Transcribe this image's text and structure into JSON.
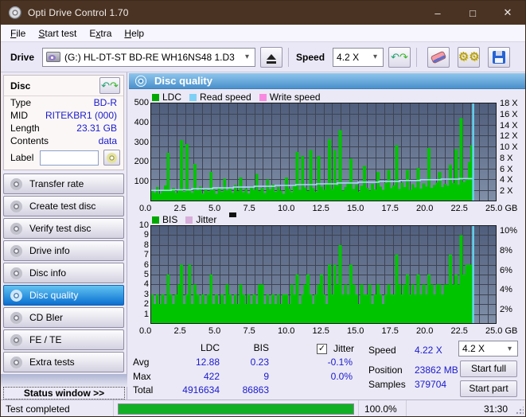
{
  "titlebar": {
    "title": "Opti Drive Control 1.70",
    "minimize": "–",
    "maximize": "□",
    "close": "✕"
  },
  "menu": {
    "items": [
      {
        "label": "File",
        "accel": 0
      },
      {
        "label": "Start test",
        "accel": 0
      },
      {
        "label": "Extra",
        "accel": 1
      },
      {
        "label": "Help",
        "accel": 0
      }
    ]
  },
  "toolbar": {
    "drive_label": "Drive",
    "drive_value": "(G:)  HL-DT-ST BD-RE  WH16NS48 1.D3",
    "speed_label": "Speed",
    "speed_value": "4.2 X",
    "icons": [
      "drive-icon",
      "eject-icon",
      "refresh-icon",
      "eraser-icon",
      "gears-icon",
      "save-icon"
    ]
  },
  "sidebar": {
    "panel_title": "Disc",
    "disc": {
      "rows": [
        {
          "label": "Type",
          "value": "BD-R"
        },
        {
          "label": "MID",
          "value": "RITEKBR1 (000)"
        },
        {
          "label": "Length",
          "value": "23.31 GB"
        },
        {
          "label": "Contents",
          "value": "data"
        }
      ],
      "label_field": {
        "label": "Label",
        "value": ""
      }
    },
    "buttons": [
      "Transfer rate",
      "Create test disc",
      "Verify test disc",
      "Drive info",
      "Disc info",
      "Disc quality",
      "CD Bler",
      "FE / TE",
      "Extra tests"
    ],
    "active_button": "Disc quality",
    "status_window": "Status window >>"
  },
  "main": {
    "header": "Disc quality"
  },
  "chart_data": [
    {
      "type": "bar",
      "title": "LDC / Read speed vs position",
      "legend": [
        {
          "label": "LDC",
          "color": "#00a800"
        },
        {
          "label": "Read speed",
          "color": "#7fd0f5"
        },
        {
          "label": "Write speed",
          "color": "#f78ae0"
        }
      ],
      "xlabel": "GB",
      "xlim": [
        0,
        25
      ],
      "x_ticks": [
        "0.0",
        "2.5",
        "5.0",
        "7.5",
        "10.0",
        "12.5",
        "15.0",
        "17.5",
        "20.0",
        "22.5",
        "25.0"
      ],
      "left_axis": {
        "ticks": [
          500,
          400,
          300,
          200,
          100
        ],
        "max": 500
      },
      "right_axis": {
        "ticks": [
          "18 X",
          "16 X",
          "14 X",
          "12 X",
          "10 X",
          "8 X",
          "6 X",
          "4 X",
          "2 X"
        ],
        "max": 18
      },
      "data_end_gb": 23.31,
      "series": [
        {
          "name": "LDC",
          "type": "bar",
          "color": "#00c400",
          "step_gb": 0.19425,
          "values": [
            60,
            45,
            72,
            38,
            55,
            80,
            245,
            52,
            68,
            42,
            58,
            310,
            49,
            290,
            63,
            44,
            190,
            57,
            75,
            41,
            66,
            50,
            150,
            61,
            39,
            73,
            48,
            115,
            56,
            70,
            44,
            82,
            53,
            120,
            47,
            65,
            40,
            76,
            58,
            140,
            52,
            69,
            43,
            110,
            61,
            85,
            49,
            72,
            55,
            38,
            120,
            64,
            47,
            78,
            250,
            59,
            230,
            70,
            52,
            260,
            66,
            48,
            230,
            75,
            58,
            90,
            315,
            62,
            260,
            80,
            360,
            55,
            72,
            95,
            215,
            63,
            85,
            49,
            78,
            180,
            68,
            54,
            88,
            60,
            150,
            74,
            58,
            92,
            160,
            66,
            80,
            285,
            62,
            95,
            72,
            160,
            58,
            86,
            70,
            170,
            64,
            90,
            75,
            270,
            68,
            82,
            95,
            150,
            72,
            88,
            78,
            185,
            92,
            265,
            85,
            422,
            96,
            110,
            200,
            285
          ]
        },
        {
          "name": "Read speed",
          "type": "line",
          "color": "#a9d7f7",
          "points_gb_speed": [
            [
              0,
              2.0
            ],
            [
              1.5,
              2.1
            ],
            [
              3,
              2.3
            ],
            [
              4.5,
              2.45
            ],
            [
              6,
              2.6
            ],
            [
              7.5,
              2.75
            ],
            [
              9,
              2.9
            ],
            [
              10.5,
              3.05
            ],
            [
              12,
              3.2
            ],
            [
              13.5,
              3.35
            ],
            [
              15,
              3.5
            ],
            [
              16.5,
              3.65
            ],
            [
              18,
              3.8
            ],
            [
              19.5,
              3.95
            ],
            [
              21,
              4.05
            ],
            [
              22.3,
              4.15
            ],
            [
              23.31,
              4.3
            ]
          ]
        },
        {
          "name": "Write speed",
          "type": "line",
          "color": "#f78ae0",
          "points_gb_speed": []
        }
      ],
      "end_marker": {
        "x_gb": 23.31,
        "color": "#66d8f4"
      },
      "grid": {
        "v_divisions": 40,
        "h_divisions": 9,
        "color": "#3d4452"
      },
      "bg_gradient": [
        "#4f5d7c",
        "#8190a8"
      ]
    },
    {
      "type": "bar",
      "title": "BIS / Jitter vs position",
      "legend": [
        {
          "label": "BIS",
          "color": "#00a800"
        },
        {
          "label": "Jitter",
          "color": "#d8aeda"
        }
      ],
      "xlabel": "GB",
      "xlim": [
        0,
        25
      ],
      "x_ticks": [
        "0.0",
        "2.5",
        "5.0",
        "7.5",
        "10.0",
        "12.5",
        "15.0",
        "17.5",
        "20.0",
        "22.5",
        "25.0"
      ],
      "left_axis": {
        "ticks": [
          10,
          9,
          8,
          7,
          6,
          5,
          4,
          3,
          2,
          1
        ],
        "max": 10
      },
      "right_axis": {
        "ticks": [
          "10%",
          "8%",
          "6%",
          "4%",
          "2%"
        ],
        "max": 10
      },
      "data_end_gb": 23.31,
      "series": [
        {
          "name": "BIS",
          "type": "bar",
          "color": "#00c400",
          "step_gb": 0.19425,
          "values": [
            3,
            2,
            3,
            2,
            3,
            2,
            5,
            3,
            2,
            3,
            4,
            6,
            2,
            3,
            6,
            2,
            4,
            3,
            2,
            3,
            2,
            3,
            5,
            2,
            3,
            2,
            3,
            2,
            4,
            3,
            2,
            3,
            2,
            4,
            3,
            2,
            3,
            2,
            3,
            2,
            4,
            4,
            2,
            3,
            2,
            3,
            2,
            3,
            2,
            3,
            3,
            2,
            4,
            3,
            5,
            2,
            3,
            4,
            5,
            3,
            2,
            3,
            4,
            5,
            3,
            2,
            6,
            3,
            6,
            4,
            8,
            3,
            4,
            3,
            6,
            4,
            3,
            2,
            4,
            3,
            3,
            4,
            2,
            3,
            4,
            3,
            2,
            3,
            4,
            3,
            3,
            7,
            4,
            3,
            4,
            5,
            3,
            4,
            3,
            5,
            3,
            4,
            3,
            5,
            4,
            3,
            4,
            4,
            3,
            4,
            4,
            7,
            4,
            5,
            4,
            9,
            5,
            6,
            6,
            6
          ]
        },
        {
          "name": "Jitter",
          "type": "line",
          "color": "#d8aeda",
          "points_gb_speed": []
        }
      ],
      "end_marker": {
        "x_gb": 23.31,
        "color": "#66d8f4"
      },
      "grid": {
        "v_divisions": 40,
        "h_divisions": 10,
        "color": "#3d4452"
      },
      "bg_gradient": [
        "#4f5d7c",
        "#8190a8"
      ]
    }
  ],
  "stats": {
    "col_ldc": "LDC",
    "col_bis": "BIS",
    "jitter_label": "Jitter",
    "jitter_checked": true,
    "rows": [
      {
        "label": "Avg",
        "ldc": "12.88",
        "bis": "0.23",
        "jitter": "-0.1%"
      },
      {
        "label": "Max",
        "ldc": "422",
        "bis": "9",
        "jitter": "0.0%"
      },
      {
        "label": "Total",
        "ldc": "4916634",
        "bis": "86863",
        "jitter": ""
      }
    ],
    "speed_label": "Speed",
    "speed_value": "4.22 X",
    "position_label": "Position",
    "position_value": "23862 MB",
    "samples_label": "Samples",
    "samples_value": "379704",
    "speed_select": "4.2 X",
    "start_full": "Start full",
    "start_part": "Start part"
  },
  "statusbar": {
    "status": "Test completed",
    "percent": "100.0%",
    "time": "31:30",
    "progress_pct": 100
  },
  "colors": {
    "accent_blue": "#1a1acd",
    "title_bar": "#4a3323",
    "progress_green": "#12b025"
  }
}
